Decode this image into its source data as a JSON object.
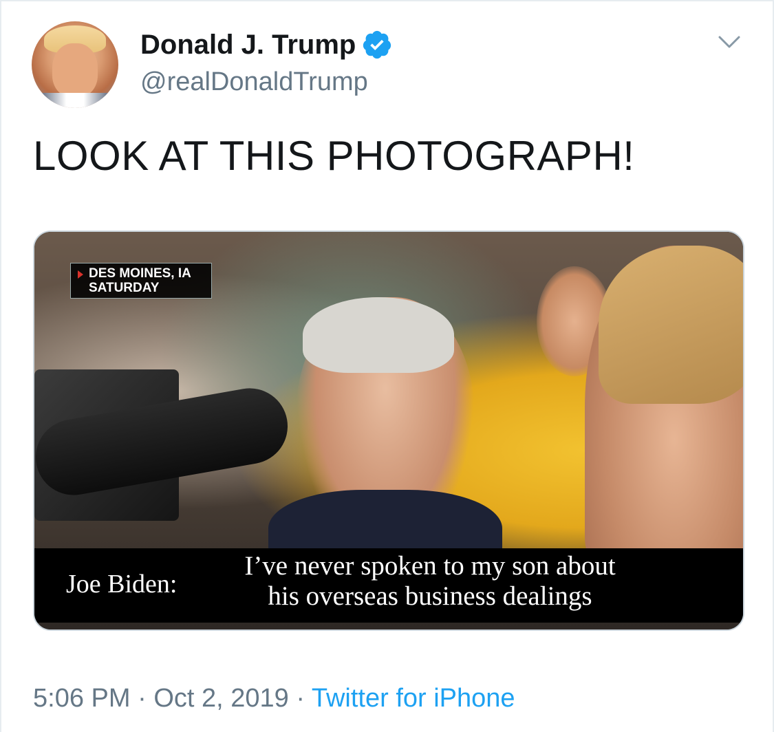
{
  "author": {
    "name": "Donald J. Trump",
    "handle": "@realDonaldTrump",
    "verified": true
  },
  "tweet": {
    "text": "LOOK AT THIS PHOTOGRAPH!"
  },
  "media": {
    "location_line1": "DES MOINES, IA",
    "location_line2": "SATURDAY",
    "speaker": "Joe Biden:",
    "quote_line1": "I’ve never spoken to my son about",
    "quote_line2": "his overseas business dealings"
  },
  "footer": {
    "time": "5:06 PM",
    "separator": "·",
    "date": "Oct 2, 2019",
    "source": "Twitter for iPhone"
  },
  "colors": {
    "verified_blue": "#1da1f2",
    "text_primary": "#14171a",
    "text_secondary": "#657786",
    "link": "#1da1f2"
  },
  "icons": {
    "verified": "verified-badge-icon",
    "menu": "chevron-down-icon"
  }
}
